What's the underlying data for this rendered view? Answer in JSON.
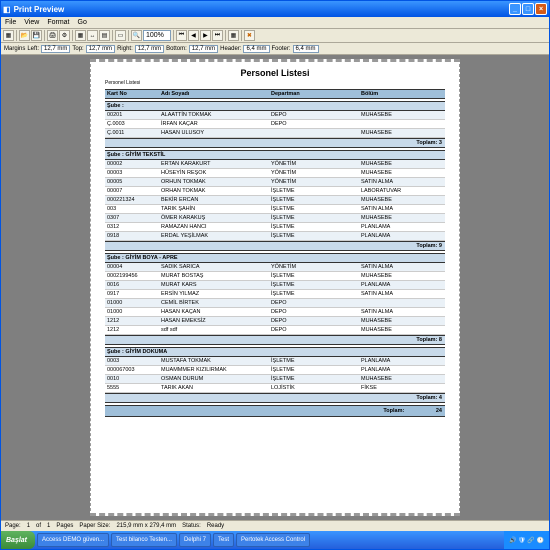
{
  "window": {
    "title": "Print Preview"
  },
  "menu": {
    "file": "File",
    "view": "View",
    "format": "Format",
    "go": "Go"
  },
  "toolbar": {
    "zoom": "100%"
  },
  "margins": {
    "label": "Margins",
    "left_l": "Left:",
    "left_v": "12,7 mm",
    "top_l": "Top:",
    "top_v": "12,7 mm",
    "right_l": "Right:",
    "right_v": "12,7 mm",
    "bottom_l": "Bottom:",
    "bottom_v": "12,7 mm",
    "header_l": "Header:",
    "header_v": "6,4 mm",
    "footer_l": "Footer:",
    "footer_v": "6,4 mm"
  },
  "report": {
    "title": "Personel Listesi",
    "plabel": "Personel Listesi",
    "cols": {
      "kart": "Kart No",
      "adi": "Adı Soyadı",
      "dep": "Departman",
      "bolum": "Bölüm"
    },
    "toplam": "Toplam:",
    "gtoplam": "Toplam:",
    "gtot": "24",
    "groups": [
      {
        "name": "Şube :",
        "tot": "3",
        "rows": [
          {
            "k": "00201",
            "a": "ALAATTİN TOKMAK",
            "d": "DEPO",
            "b": "MUHASEBE"
          },
          {
            "k": "Ç.0003",
            "a": "İRFAN KAÇAR",
            "d": "DEPO",
            "b": ""
          },
          {
            "k": "Ç.0011",
            "a": "HASAN ULUSOY",
            "d": "",
            "b": "MUHASEBE"
          }
        ]
      },
      {
        "name": "Şube : GİYİM TEKSTİL",
        "tot": "9",
        "rows": [
          {
            "k": "00002",
            "a": "ERTAN KARAKURT",
            "d": "YÖNETİM",
            "b": "MUHASEBE"
          },
          {
            "k": "00003",
            "a": "HÜSEYİN REŞOK",
            "d": "YÖNETİM",
            "b": "MUHASEBE"
          },
          {
            "k": "00005",
            "a": "ORHUN TOKMAK",
            "d": "YÖNETİM",
            "b": "SATIN ALMA"
          },
          {
            "k": "00007",
            "a": "ORHAN TOKMAK",
            "d": "İŞLETME",
            "b": "LABORATUVAR"
          },
          {
            "k": "000221324",
            "a": "BEKİR ERCAN",
            "d": "İŞLETME",
            "b": "MUHASEBE"
          },
          {
            "k": "003",
            "a": "TARIK ŞAHİN",
            "d": "İŞLETME",
            "b": "SATIN ALMA"
          },
          {
            "k": "0307",
            "a": "ÖMER KARAKUŞ",
            "d": "İŞLETME",
            "b": "MUHASEBE"
          },
          {
            "k": "0312",
            "a": "RAMAZAN HANCI",
            "d": "İŞLETME",
            "b": "PLANLAMA"
          },
          {
            "k": "0918",
            "a": "ERDAL YEŞİLMAK",
            "d": "İŞLETME",
            "b": "PLANLAMA"
          }
        ]
      },
      {
        "name": "Şube : GİYİM BOYA - APRE",
        "tot": "8",
        "rows": [
          {
            "k": "00004",
            "a": "SADIK SARICA",
            "d": "YÖNETİM",
            "b": "SATIN ALMA"
          },
          {
            "k": "0002199456",
            "a": "MURAT BOSTAŞ",
            "d": "İŞLETME",
            "b": "MUHASEBE"
          },
          {
            "k": "0016",
            "a": "MURAT KARS",
            "d": "İŞLETME",
            "b": "PLANLAMA"
          },
          {
            "k": "0917",
            "a": "ERSİN YILMAZ",
            "d": "İŞLETME",
            "b": "SATIN ALMA"
          },
          {
            "k": "01000",
            "a": "CEMİL BİRTEK",
            "d": "DEPO",
            "b": ""
          },
          {
            "k": "01000",
            "a": "HASAN KAÇAN",
            "d": "DEPO",
            "b": "SATIN ALMA"
          },
          {
            "k": "1212",
            "a": "HASAN EMEKSİZ",
            "d": "DEPO",
            "b": "MUHASEBE"
          },
          {
            "k": "1212",
            "a": "sdf sdf",
            "d": "DEPO",
            "b": "MUHASEBE"
          }
        ]
      },
      {
        "name": "Şube : GİYİM DOKUMA",
        "tot": "4",
        "rows": [
          {
            "k": "0003",
            "a": "MUSTAFA TOKMAK",
            "d": "İŞLETME",
            "b": "PLANLAMA"
          },
          {
            "k": "000067003",
            "a": "MUAMMMER KIZILIRMAK",
            "d": "İŞLETME",
            "b": "PLANLAMA"
          },
          {
            "k": "0010",
            "a": "OSMAN DURUM",
            "d": "İŞLETME",
            "b": "MUHASEBE"
          },
          {
            "k": "5555",
            "a": "TARIK AKAN",
            "d": "LOJİSTİK",
            "b": "FİKSE"
          }
        ]
      }
    ]
  },
  "status": {
    "page_l": "Page:",
    "page_v": "1",
    "of": "of",
    "pages_v": "1",
    "pages_l": "Pages",
    "size_l": "Paper Size:",
    "size_v": "215,9 mm x 279,4 mm",
    "stat_l": "Status:",
    "stat_v": "Ready"
  },
  "taskbar": {
    "start": "Başlat",
    "btns": [
      "Access DEMO güven...",
      "Test bilanco Testen...",
      "Delphi 7",
      "Test",
      "Pertotek Access Control"
    ],
    "time": ""
  }
}
